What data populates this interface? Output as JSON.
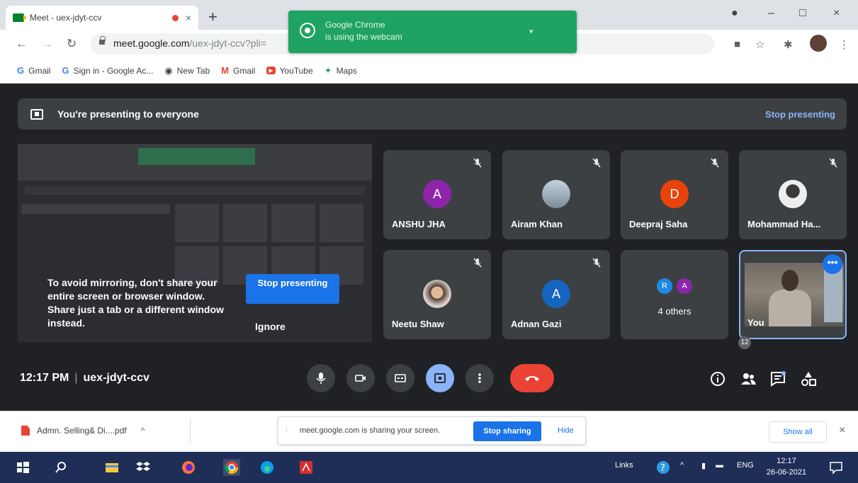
{
  "browser": {
    "tab_title": "Meet - uex-jdyt-ccv",
    "tab_close": "×",
    "new_tab": "+",
    "url_domain": "meet.google.com",
    "url_path": "/uex-jdyt-ccv?pli=",
    "toast": {
      "title": "Google Chrome",
      "subtitle": "is using the webcam"
    },
    "window_controls": {
      "minimize": "–",
      "maximize": "□",
      "close": "×"
    },
    "bookmarks": [
      {
        "icon": "G",
        "label": "Gmail"
      },
      {
        "icon": "G",
        "label": "Sign in - Google Ac..."
      },
      {
        "icon": "◉",
        "label": "New Tab"
      },
      {
        "icon": "M",
        "label": "Gmail"
      },
      {
        "icon": "▶",
        "label": "YouTube"
      },
      {
        "icon": "✦",
        "label": "Maps"
      }
    ]
  },
  "meet": {
    "presenting_text": "You're presenting to everyone",
    "stop_presenting_link": "Stop presenting",
    "preview_warning": "To avoid mirroring, don't share your entire screen or browser window. Share just a tab or a different window instead.",
    "stop_presenting_button": "Stop presenting",
    "ignore_button": "Ignore",
    "participants": [
      {
        "name": "ANSHU JHA",
        "initial": "A",
        "color": "#8e24aa"
      },
      {
        "name": "Airam Khan",
        "initial": "",
        "color": "#90a4ae"
      },
      {
        "name": "Deepraj Saha",
        "initial": "D",
        "color": "#e8430a"
      },
      {
        "name": "Mohammad Ha...",
        "initial": "",
        "color": "#eeeeee"
      },
      {
        "name": "Neetu Shaw",
        "initial": "",
        "color": "#d7ccc8"
      },
      {
        "name": "Adnan Gazi",
        "initial": "A",
        "color": "#1565c0"
      }
    ],
    "others": {
      "label": "4 others",
      "initials": [
        "R",
        "A"
      ],
      "colors": [
        "#1e88e5",
        "#8e24aa"
      ]
    },
    "self_label": "You",
    "more_options": "•••",
    "time": "12:17 PM",
    "meeting_code": "uex-jdyt-ccv",
    "people_count": "12"
  },
  "downloads": {
    "file_name": "Admn. Selling& Di....pdf",
    "chevron": "^",
    "share_notice": "meet.google.com is sharing your screen.",
    "stop_sharing": "Stop sharing",
    "hide": "Hide",
    "show_all": "Show all",
    "close": "×"
  },
  "taskbar": {
    "links_label": "Links",
    "lang": "ENG",
    "time": "12:17",
    "date": "26-06-2021"
  }
}
